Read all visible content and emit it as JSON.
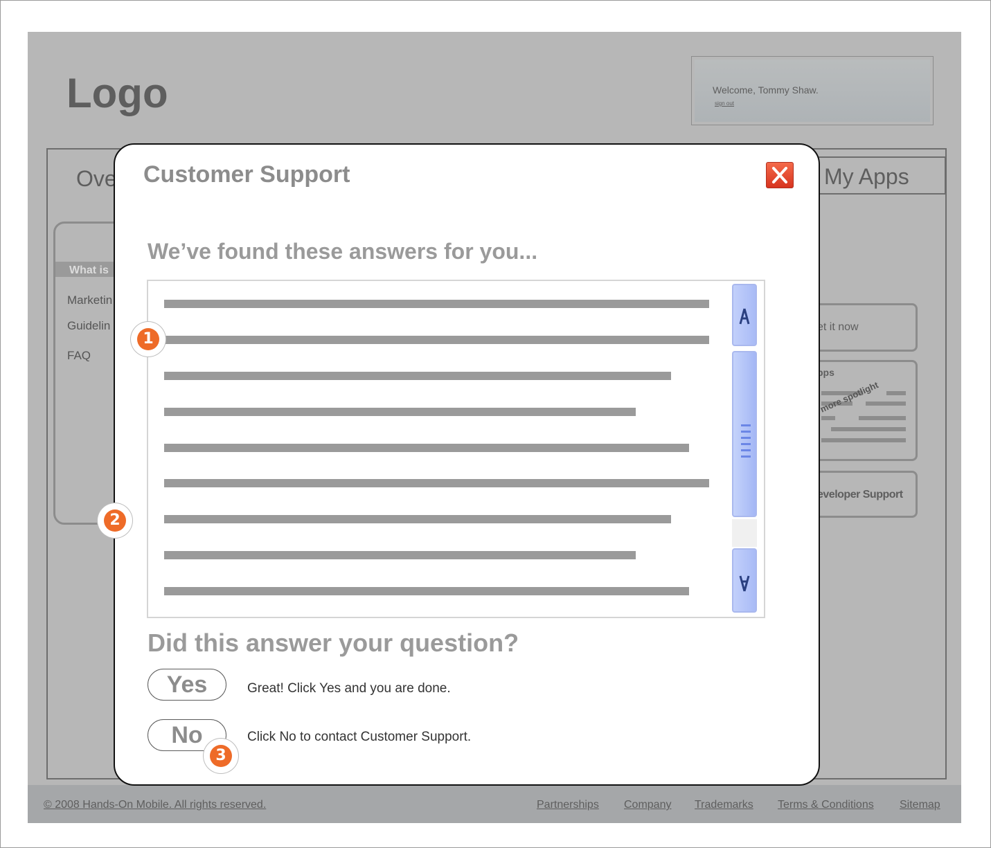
{
  "logo": "Logo",
  "user": {
    "welcome": "Welcome, Tommy Shaw.",
    "signout": "sign out"
  },
  "tabs": {
    "overview_partial": "Ove",
    "my_apps": "My Apps"
  },
  "left_panel": {
    "header_partial": "What is",
    "links": [
      "Marketin",
      "Guidelin",
      "FAQ"
    ]
  },
  "right_panel": {
    "get_it_partial": "et it now",
    "apps_partial": "pps",
    "spotlight": "more spotlight",
    "dev_support_partial": "eveloper Support"
  },
  "modal": {
    "title": "Customer Support",
    "found_heading": "We’ve found these answers for you...",
    "question": "Did this answer your question?",
    "yes_label": "Yes",
    "yes_desc": "Great! Click Yes and you are done.",
    "no_label": "No",
    "no_desc": "Click No to contact Customer Support."
  },
  "annotations": [
    "1",
    "2",
    "3"
  ],
  "footer": {
    "copyright": "© 2008 Hands-On Mobile. All rights reserved.",
    "links": [
      "Partnerships",
      "Company",
      "Trademarks",
      "Terms & Conditions",
      "Sitemap"
    ]
  },
  "colors": {
    "accent_orange": "#ee6b28",
    "close_red": "#e04a2f",
    "scrollbar_blue": "#b8c8f9"
  }
}
